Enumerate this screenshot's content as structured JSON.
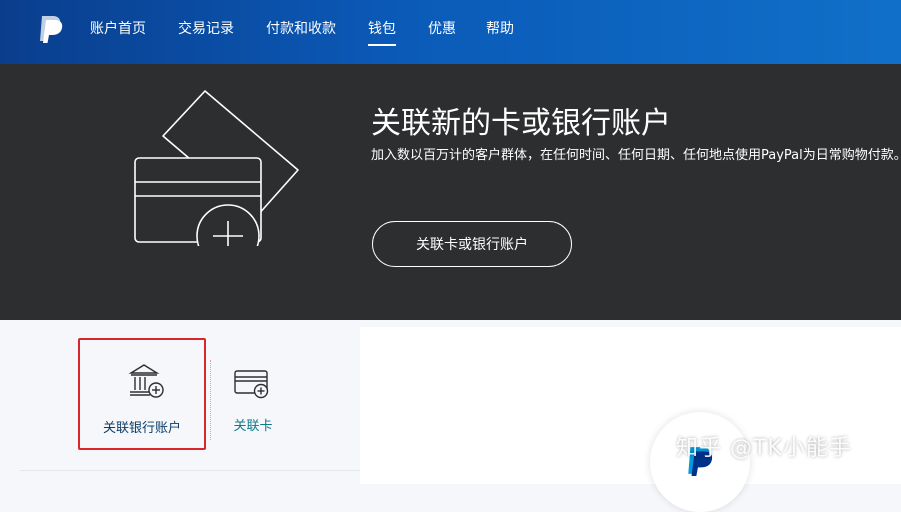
{
  "nav": {
    "items": [
      {
        "label": "账户首页"
      },
      {
        "label": "交易记录"
      },
      {
        "label": "付款和收款"
      },
      {
        "label": "钱包"
      },
      {
        "label": "优惠"
      },
      {
        "label": "帮助"
      }
    ],
    "active": "钱包"
  },
  "hero": {
    "title": "关联新的卡或银行账户",
    "description": "加入数以百万计的客户群体，在任何时间、任何日期、任何地点使用PayPal为日常购物付款。",
    "button_label": "关联卡或银行账户"
  },
  "options": {
    "bank_label": "关联银行账户",
    "card_label": "关联卡"
  },
  "watermark": "知乎 @TK小能手",
  "colors": {
    "nav_bg": "#0b5ab8",
    "hero_bg": "#2c2e2f",
    "highlight_border": "#d9262c",
    "link": "#117a8b"
  }
}
